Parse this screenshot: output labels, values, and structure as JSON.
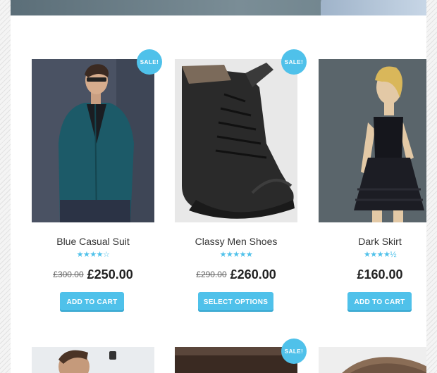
{
  "products": [
    {
      "name": "Blue Casual Suit",
      "sale_badge": "SALE!",
      "old_price": "£300.00",
      "price": "£250.00",
      "button": "ADD TO CART",
      "rating_icons": "★★★★☆"
    },
    {
      "name": "Classy Men Shoes",
      "sale_badge": "SALE!",
      "old_price": "£290.00",
      "price": "£260.00",
      "button": "SELECT OPTIONS",
      "rating_icons": "★★★★★"
    },
    {
      "name": "Dark Skirt",
      "price": "£160.00",
      "button": "ADD TO CART",
      "rating_icons": "★★★★½"
    }
  ],
  "next_row": {
    "sale_badge": "SALE!"
  },
  "colors": {
    "accent": "#4fc1ea",
    "price": "#222222"
  }
}
